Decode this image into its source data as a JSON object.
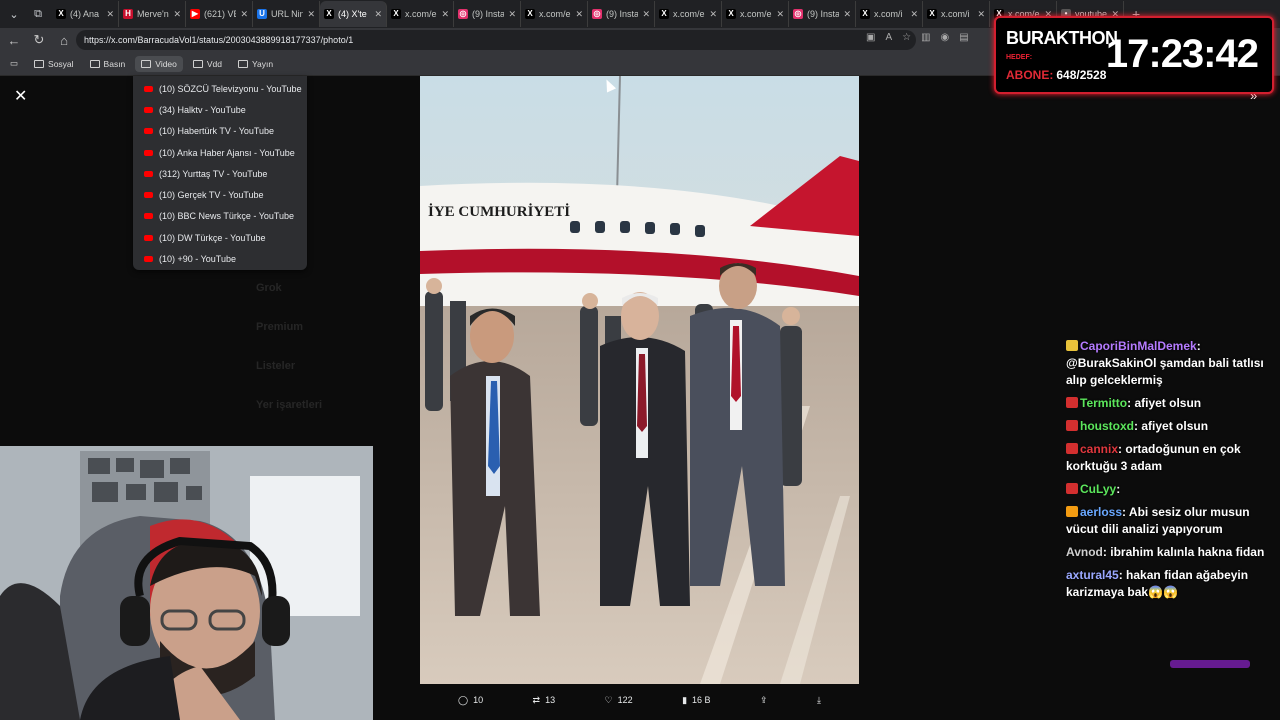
{
  "tabs": [
    {
      "label": "(4) Ana",
      "fav_color": "#000000",
      "fav": "X"
    },
    {
      "label": "Merve'n",
      "fav_color": "#c8102e",
      "fav": "H"
    },
    {
      "label": "(621) VE",
      "fav_color": "#ff0000",
      "fav": "▶"
    },
    {
      "label": "URL Nin",
      "fav_color": "#1a73e8",
      "fav": "U"
    },
    {
      "label": "(4) X'te",
      "fav_color": "#000000",
      "fav": "X",
      "active": true
    },
    {
      "label": "x.com/e",
      "fav_color": "#000000",
      "fav": "X"
    },
    {
      "label": "(9) Insta",
      "fav_color": "#e1306c",
      "fav": "◎"
    },
    {
      "label": "x.com/e",
      "fav_color": "#000000",
      "fav": "X"
    },
    {
      "label": "(9) Insta",
      "fav_color": "#e1306c",
      "fav": "◎"
    },
    {
      "label": "x.com/e",
      "fav_color": "#000000",
      "fav": "X"
    },
    {
      "label": "x.com/e",
      "fav_color": "#000000",
      "fav": "X"
    },
    {
      "label": "(9) Insta",
      "fav_color": "#e1306c",
      "fav": "◎"
    },
    {
      "label": "x.com/i",
      "fav_color": "#000000",
      "fav": "X"
    },
    {
      "label": "x.com/i",
      "fav_color": "#000000",
      "fav": "X"
    },
    {
      "label": "x.com/e",
      "fav_color": "#000000",
      "fav": "X"
    },
    {
      "label": "youtube",
      "fav_color": "#555555",
      "fav": "•"
    }
  ],
  "address": {
    "url": "https://x.com/BarracudaVol1/status/2003043889918177337/photo/1"
  },
  "bookmarks": [
    {
      "label": "Sosyal"
    },
    {
      "label": "Basın"
    },
    {
      "label": "Video",
      "open": true
    },
    {
      "label": "Vdd"
    },
    {
      "label": "Yayın"
    }
  ],
  "dropdown": [
    "(10) SÖZCÜ Televizyonu - YouTube",
    "(34) Halktv - YouTube",
    "(10) Habertürk TV - YouTube",
    "(10) Anka Haber Ajansı - YouTube",
    "(312) Yurttaş TV - YouTube",
    "(10) Gerçek TV - YouTube",
    "(10) BBC News Türkçe - YouTube",
    "(10) DW Türkçe - YouTube",
    "(10) +90 - YouTube"
  ],
  "photo": {
    "plane_text": "İYE CUMHURİYETİ"
  },
  "actions": {
    "replies": "10",
    "reposts": "13",
    "likes": "122",
    "views": "16 B"
  },
  "overlay": {
    "name": "BURAKTHON",
    "goal_label": "HEDEF:",
    "subs_label": "ABONE:",
    "subs_value": "648/2528",
    "time": "17:23:42"
  },
  "chat": [
    {
      "user": "CaporiBinMalDemek",
      "color": "#b57bff",
      "text": "@BurakSakinOl şamdan bali tatlısı alıp gelceklermiş",
      "badge": "yellow"
    },
    {
      "user": "Termitto",
      "color": "#5ce65c",
      "text": "afiyet olsun",
      "badge": "red"
    },
    {
      "user": "houstoxd",
      "color": "#5ce65c",
      "text": "afiyet olsun",
      "badge": "red"
    },
    {
      "user": "cannix",
      "color": "#e0383e",
      "text": "ortadoğunun en çok korktuğu 3 adam",
      "badge": "red"
    },
    {
      "user": "CuLyy",
      "color": "#5ce65c",
      "text": "",
      "badge": "red"
    },
    {
      "user": "aerloss",
      "color": "#6aa8ff",
      "text": "Abi sesiz olur musun vücut dili analizi yapıyorum",
      "badge": "orange"
    },
    {
      "user": "Avnod",
      "color": "#cfcfcf",
      "text": "ibrahim kalınla hakna fidan",
      "badge": ""
    },
    {
      "user": "axtural45",
      "color": "#9aa8ff",
      "text": "hakan fidan ağabeyin karizmaya bak😱😱",
      "badge": ""
    }
  ],
  "ghost_menu": [
    "Grok",
    "Premium",
    "Listeler",
    "Yer işaretleri"
  ],
  "colors": {
    "accent": "#d21f2f",
    "chrome": "#35363a",
    "tabbar": "#202124"
  }
}
